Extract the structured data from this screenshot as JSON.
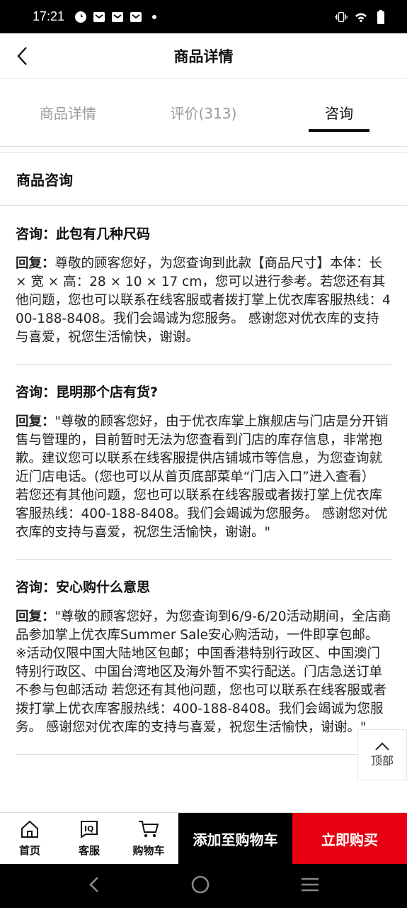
{
  "status_bar": {
    "time": "17:21"
  },
  "header": {
    "title": "商品详情"
  },
  "tabs": [
    {
      "label": "商品详情",
      "active": false
    },
    {
      "label": "评价(313)",
      "active": false
    },
    {
      "label": "咨询",
      "active": true
    }
  ],
  "section": {
    "title": "商品咨询"
  },
  "qa": [
    {
      "question": "咨询：此包有几种尺码",
      "answer_label": "回复：",
      "answer": "尊敬的顾客您好，为您查询到此款【商品尺寸】本体：长 × 宽 × 高：28 × 10 × 17 cm，您可以进行参考。若您还有其他问题，您也可以联系在线客服或者拨打掌上优衣库客服热线：400-188-8408。我们会竭诚为您服务。 感谢您对优衣库的支持与喜爱，祝您生活愉快，谢谢。"
    },
    {
      "question": "咨询：昆明那个店有货?",
      "answer_label": "回复：",
      "answer": "\"尊敬的顾客您好，由于优衣库掌上旗舰店与门店是分开销售与管理的，目前暂时无法为您查看到门店的库存信息，非常抱歉。建议您可以联系在线客服提供店铺城市等信息，为您查询就近门店电话。(您也可以从首页底部菜单“门店入口”进入查看） 若您还有其他问题，您也可以联系在线客服或者拨打掌上优衣库客服热线：400-188-8408。我们会竭诚为您服务。 感谢您对优衣库的支持与喜爱，祝您生活愉快，谢谢。\""
    },
    {
      "question": "咨询：安心购什么意思",
      "answer_label": "回复：",
      "answer": "\"尊敬的顾客您好，为您查询到6/9-6/20活动期间，全店商品参加掌上优衣库Summer Sale安心购活动，一件即享包邮。 ※活动仅限中国大陆地区包邮；中国香港特别行政区、中国澳门特别行政区、中国台湾地区及海外暂不实行配送。门店急送订单不参与包邮活动 若您还有其他问题，您也可以联系在线客服或者拨打掌上优衣库客服热线：400-188-8408。我们会竭诚为您服务。 感谢您对优衣库的支持与喜爱，祝您生活愉快，谢谢。\""
    }
  ],
  "back_to_top": {
    "label": "顶部"
  },
  "bottom_nav": {
    "home": "首页",
    "service": "客服",
    "cart": "购物车",
    "add_to_cart": "添加至购物车",
    "buy_now": "立即购买"
  },
  "colors": {
    "accent_red": "#e60012",
    "black": "#000000"
  }
}
